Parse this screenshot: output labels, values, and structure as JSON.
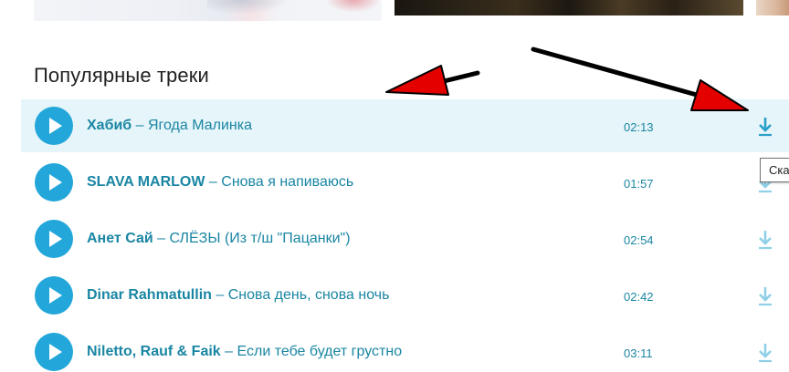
{
  "section": {
    "title": "Популярные треки"
  },
  "tracks": [
    {
      "artist": "Хабиб",
      "separator": " – ",
      "song": "Ягода Малинка",
      "duration": "02:13",
      "active": true
    },
    {
      "artist": "SLAVA MARLOW",
      "separator": " – ",
      "song": "Снова я напиваюсь",
      "duration": "01:57",
      "active": false
    },
    {
      "artist": "Анет Сай",
      "separator": " – ",
      "song": "СЛЁЗЫ (Из т/ш \"Пацанки\")",
      "duration": "02:54",
      "active": false
    },
    {
      "artist": "Dinar Rahmatullin",
      "separator": " – ",
      "song": "Снова день, снова ночь",
      "duration": "02:42",
      "active": false
    },
    {
      "artist": "Niletto, Rauf & Faik",
      "separator": " – ",
      "song": "Если тебе будет грустно",
      "duration": "03:11",
      "active": false
    }
  ],
  "tooltip": {
    "text": "Ска"
  },
  "icons": {
    "play": "play-icon",
    "download": "download-icon"
  },
  "colors": {
    "accent": "#23a7da",
    "link": "#1a86a3",
    "active_row": "#e6f5f9",
    "download_active": "#2a9fc9",
    "download_idle": "#8fd0e8",
    "annotation_arrow": "#e50000"
  }
}
